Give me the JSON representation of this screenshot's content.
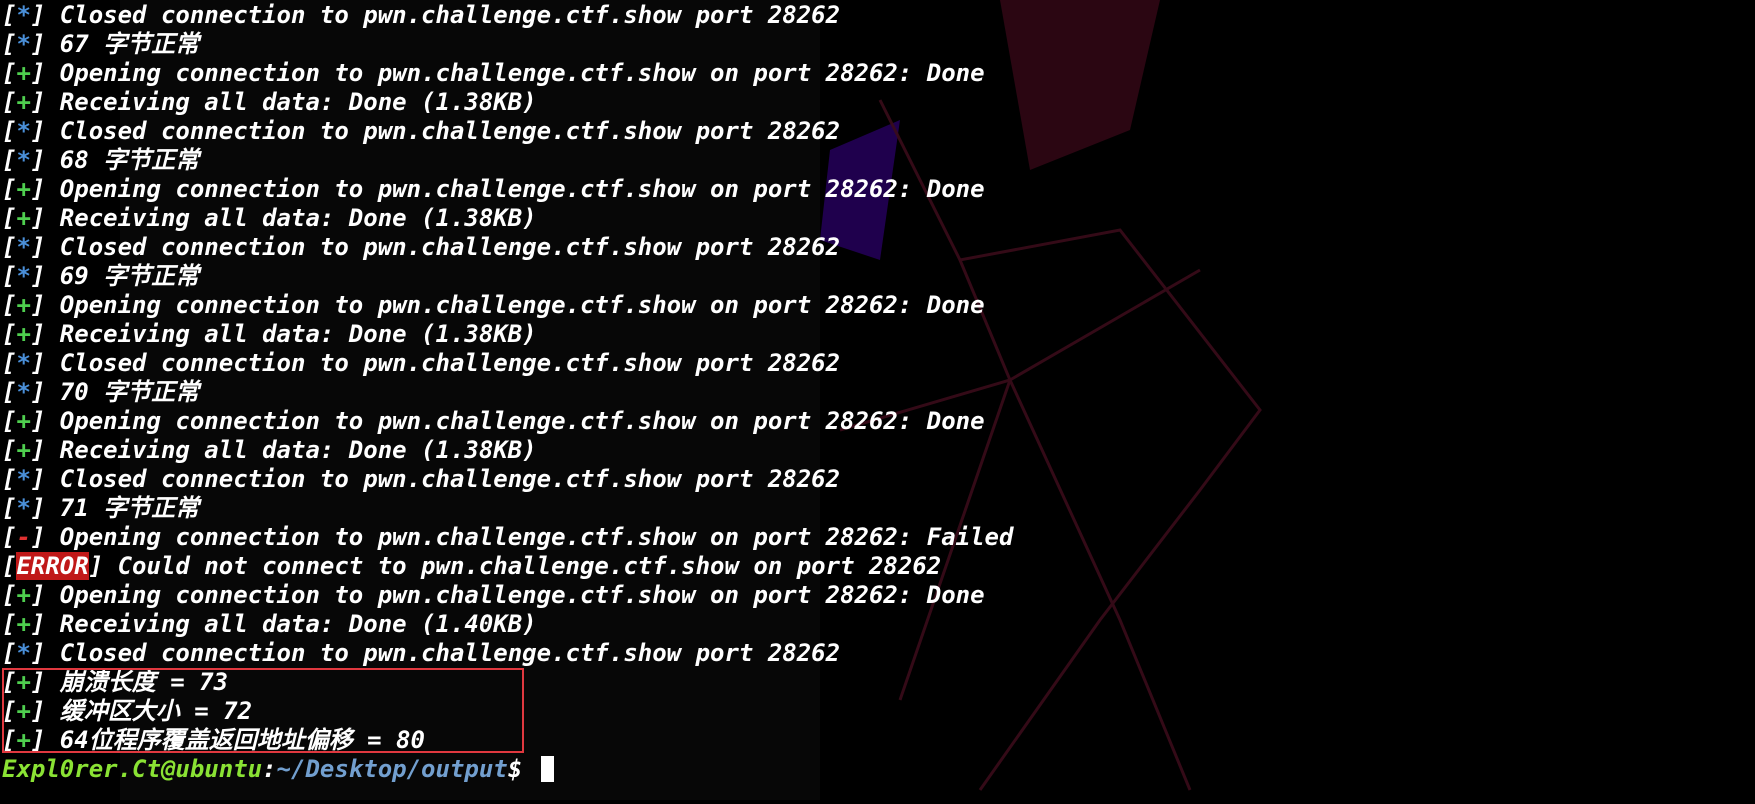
{
  "terminal": {
    "lines": [
      {
        "mark": "*",
        "text": " Closed connection to pwn.challenge.ctf.show port 28262"
      },
      {
        "mark": "*",
        "text": " 67 字节正常"
      },
      {
        "mark": "+",
        "text": " Opening connection to pwn.challenge.ctf.show on port 28262: Done"
      },
      {
        "mark": "+",
        "text": " Receiving all data: Done (1.38KB)"
      },
      {
        "mark": "*",
        "text": " Closed connection to pwn.challenge.ctf.show port 28262"
      },
      {
        "mark": "*",
        "text": " 68 字节正常"
      },
      {
        "mark": "+",
        "text": " Opening connection to pwn.challenge.ctf.show on port 28262: Done"
      },
      {
        "mark": "+",
        "text": " Receiving all data: Done (1.38KB)"
      },
      {
        "mark": "*",
        "text": " Closed connection to pwn.challenge.ctf.show port 28262"
      },
      {
        "mark": "*",
        "text": " 69 字节正常"
      },
      {
        "mark": "+",
        "text": " Opening connection to pwn.challenge.ctf.show on port 28262: Done"
      },
      {
        "mark": "+",
        "text": " Receiving all data: Done (1.38KB)"
      },
      {
        "mark": "*",
        "text": " Closed connection to pwn.challenge.ctf.show port 28262"
      },
      {
        "mark": "*",
        "text": " 70 字节正常"
      },
      {
        "mark": "+",
        "text": " Opening connection to pwn.challenge.ctf.show on port 28262: Done"
      },
      {
        "mark": "+",
        "text": " Receiving all data: Done (1.38KB)"
      },
      {
        "mark": "*",
        "text": " Closed connection to pwn.challenge.ctf.show port 28262"
      },
      {
        "mark": "*",
        "text": " 71 字节正常"
      },
      {
        "mark": "-",
        "text": " Opening connection to pwn.challenge.ctf.show on port 28262: Failed"
      },
      {
        "mark": "ERROR",
        "text": " Could not connect to pwn.challenge.ctf.show on port 28262"
      },
      {
        "mark": "+",
        "text": " Opening connection to pwn.challenge.ctf.show on port 28262: Done"
      },
      {
        "mark": "+",
        "text": " Receiving all data: Done (1.40KB)"
      },
      {
        "mark": "*",
        "text": " Closed connection to pwn.challenge.ctf.show port 28262"
      },
      {
        "mark": "+",
        "text": " 崩溃长度 = 73"
      },
      {
        "mark": "+",
        "text": " 缓冲区大小 = 72"
      },
      {
        "mark": "+",
        "text": " 64位程序覆盖返回地址偏移 = 80"
      }
    ],
    "prompt": {
      "user": "Expl0rer.Ct@ubuntu",
      "sep": ":",
      "path": "~/Desktop/output",
      "symbol": "$ "
    }
  },
  "colors": {
    "background": "#000000",
    "star": "#4a8fd8",
    "plus": "#4fcf4f",
    "minus": "#e03030",
    "error_bg": "#c01818",
    "prompt_user": "#8ae234",
    "prompt_path": "#729fcf",
    "highlight_box": "#e0383f"
  }
}
